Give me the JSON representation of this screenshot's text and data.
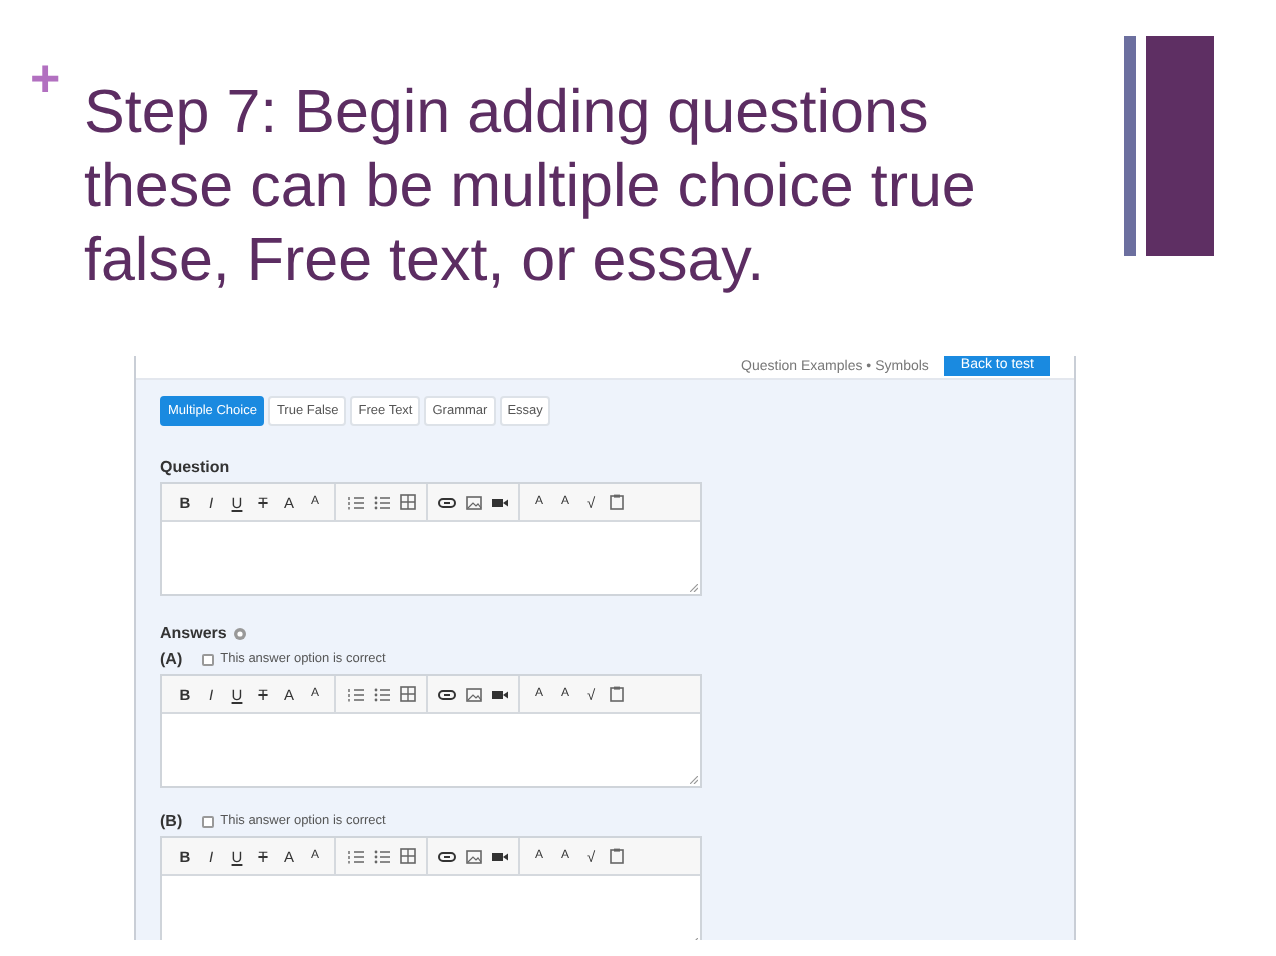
{
  "slide": {
    "bullet": "+",
    "title": "Step 7: Begin adding questions these can be multiple choice true false, Free text, or essay."
  },
  "screenshot": {
    "header": {
      "link": "Question Examples • Symbols",
      "button": "Back to test"
    },
    "tabs": [
      {
        "label": "Multiple Choice",
        "selected": true
      },
      {
        "label": "True False",
        "selected": false
      },
      {
        "label": "Free Text",
        "selected": false
      },
      {
        "label": "Grammar",
        "selected": false
      },
      {
        "label": "Essay",
        "selected": false
      }
    ],
    "question": {
      "label": "Question",
      "toolbar": [
        {
          "kind": "bold",
          "label": "B"
        },
        {
          "kind": "italic",
          "label": "I"
        },
        {
          "kind": "underline",
          "label": "U"
        },
        {
          "kind": "strike",
          "label": "T"
        },
        {
          "kind": "color",
          "label": "A"
        },
        {
          "kind": "size",
          "label": "A"
        },
        {
          "kind": "divider"
        },
        {
          "kind": "ordered"
        },
        {
          "kind": "bullet"
        },
        {
          "kind": "table"
        },
        {
          "kind": "divider"
        },
        {
          "kind": "link"
        },
        {
          "kind": "image"
        },
        {
          "kind": "video"
        },
        {
          "kind": "divider"
        },
        {
          "kind": "sup",
          "label": "A"
        },
        {
          "kind": "sub",
          "label": "A"
        },
        {
          "kind": "math",
          "label": "√"
        },
        {
          "kind": "paste"
        }
      ]
    },
    "answers_label": "Answers",
    "answers": [
      {
        "letter": "(A)",
        "checkbox_label": "This answer option is correct",
        "checked": false,
        "toolbar": [
          {
            "kind": "bold",
            "label": "B"
          },
          {
            "kind": "italic",
            "label": "I"
          },
          {
            "kind": "underline",
            "label": "U"
          },
          {
            "kind": "strike",
            "label": "T"
          },
          {
            "kind": "color",
            "label": "A"
          },
          {
            "kind": "size",
            "label": "A"
          },
          {
            "kind": "divider"
          },
          {
            "kind": "ordered"
          },
          {
            "kind": "bullet"
          },
          {
            "kind": "table"
          },
          {
            "kind": "divider"
          },
          {
            "kind": "link"
          },
          {
            "kind": "image"
          },
          {
            "kind": "video"
          },
          {
            "kind": "divider"
          },
          {
            "kind": "sup",
            "label": "A"
          },
          {
            "kind": "sub",
            "label": "A"
          },
          {
            "kind": "math",
            "label": "√"
          },
          {
            "kind": "paste"
          }
        ]
      },
      {
        "letter": "(B)",
        "checkbox_label": "This answer option is correct",
        "checked": false,
        "toolbar": [
          {
            "kind": "bold",
            "label": "B"
          },
          {
            "kind": "italic",
            "label": "I"
          },
          {
            "kind": "underline",
            "label": "U"
          },
          {
            "kind": "strike",
            "label": "T"
          },
          {
            "kind": "color",
            "label": "A"
          },
          {
            "kind": "size",
            "label": "A"
          },
          {
            "kind": "divider"
          },
          {
            "kind": "ordered"
          },
          {
            "kind": "bullet"
          },
          {
            "kind": "table"
          },
          {
            "kind": "divider"
          },
          {
            "kind": "link"
          },
          {
            "kind": "image"
          },
          {
            "kind": "video"
          },
          {
            "kind": "divider"
          },
          {
            "kind": "sup",
            "label": "A"
          },
          {
            "kind": "sub",
            "label": "A"
          },
          {
            "kind": "math",
            "label": "√"
          },
          {
            "kind": "paste"
          }
        ]
      }
    ]
  }
}
